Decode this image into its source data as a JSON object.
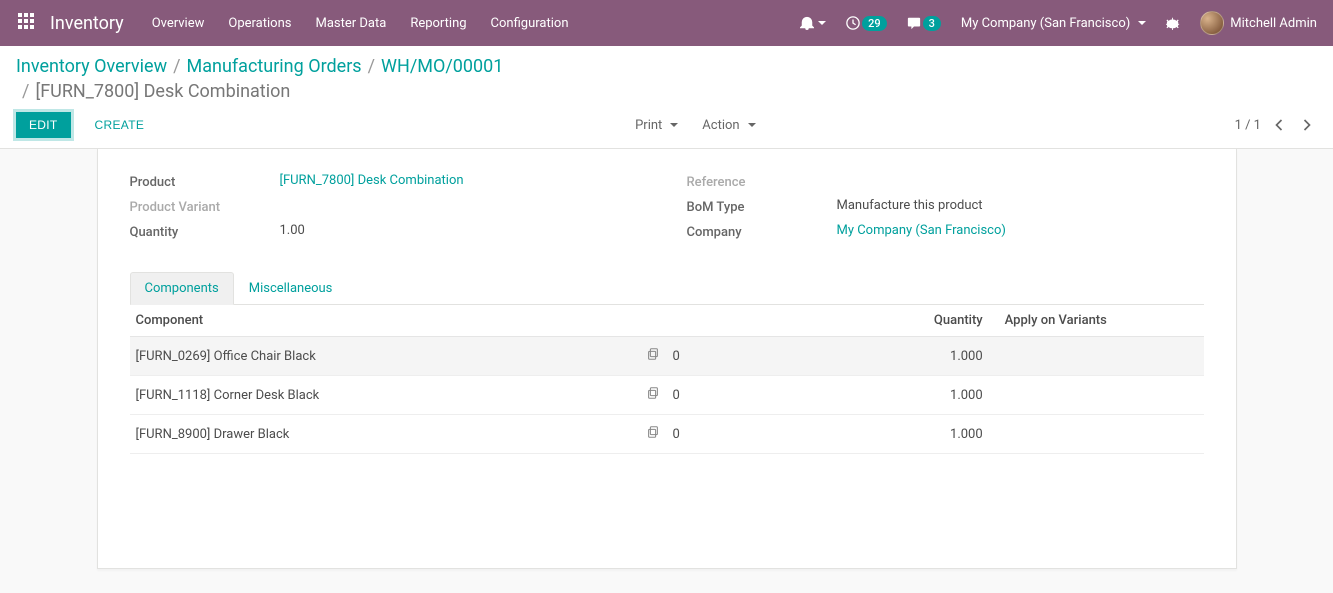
{
  "header": {
    "brand": "Inventory",
    "menu": [
      "Overview",
      "Operations",
      "Master Data",
      "Reporting",
      "Configuration"
    ],
    "badge_clock": "29",
    "badge_msg": "3",
    "company": "My Company (San Francisco)",
    "username": "Mitchell Admin"
  },
  "breadcrumb": {
    "items": [
      "Inventory Overview",
      "Manufacturing Orders",
      "WH/MO/00001"
    ],
    "current": "[FURN_7800] Desk Combination"
  },
  "buttons": {
    "edit": "Edit",
    "create": "Create",
    "print": "Print",
    "action": "Action"
  },
  "pager": {
    "text": "1 / 1"
  },
  "form": {
    "left": {
      "product_label": "Product",
      "product_value": "[FURN_7800] Desk Combination",
      "variant_label": "Product Variant",
      "variant_value": "",
      "qty_label": "Quantity",
      "qty_value": "1.00"
    },
    "right": {
      "ref_label": "Reference",
      "ref_value": "",
      "bom_label": "BoM Type",
      "bom_value": "Manufacture this product",
      "company_label": "Company",
      "company_value": "My Company (San Francisco)"
    }
  },
  "tabs": {
    "components": "Components",
    "misc": "Miscellaneous"
  },
  "table": {
    "headers": {
      "component": "Component",
      "qty": "Quantity",
      "apply": "Apply on Variants"
    },
    "rows": [
      {
        "component": "[FURN_0269] Office Chair Black",
        "extra": "0",
        "qty": "1.000",
        "apply": "",
        "highlighted": true
      },
      {
        "component": "[FURN_1118] Corner Desk Black",
        "extra": "0",
        "qty": "1.000",
        "apply": "",
        "highlighted": false
      },
      {
        "component": "[FURN_8900] Drawer Black",
        "extra": "0",
        "qty": "1.000",
        "apply": "",
        "highlighted": false
      }
    ]
  }
}
